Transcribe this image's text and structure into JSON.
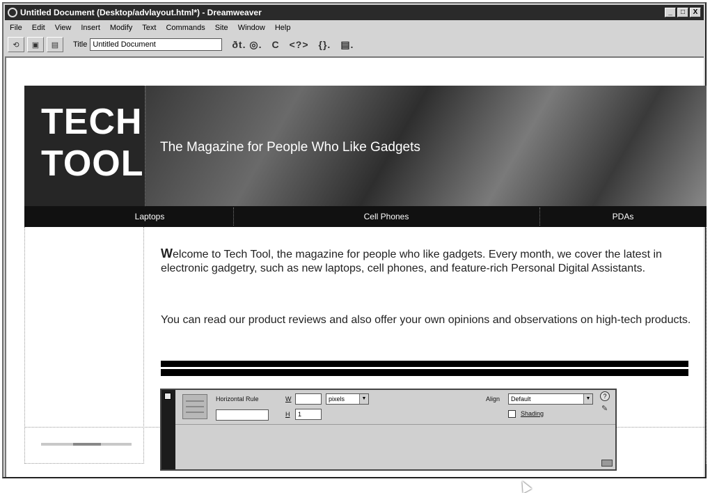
{
  "window": {
    "title": "Untitled Document (Desktop/advlayout.html*) - Dreamweaver",
    "controls": [
      "_",
      "□",
      "X"
    ]
  },
  "menu": [
    "File",
    "Edit",
    "View",
    "Insert",
    "Modify",
    "Text",
    "Commands",
    "Site",
    "Window",
    "Help"
  ],
  "toolbar": {
    "title_label": "Title",
    "title_value": "Untitled Document",
    "symbols": [
      "ðt. ◎.",
      "C",
      "<?>",
      "{}.",
      "▤."
    ]
  },
  "page": {
    "logo_line1": "TECH",
    "logo_line2": "TOOL",
    "tagline": "The Magazine for People Who Like Gadgets",
    "nav": [
      "Laptops",
      "Cell Phones",
      "PDAs"
    ],
    "para1_first": "W",
    "para1_rest": "elcome to Tech Tool, the magazine for people who like gadgets. Every month, we cover the latest in electronic gadgetry, such as new laptops, cell phones, and feature-rich Personal Digital Assistants.",
    "para2": "You can read our product reviews and also offer your own opinions and observations on high-tech products."
  },
  "property_inspector": {
    "element_label": "Horizontal Rule",
    "w_label": "W",
    "h_label": "H",
    "w_value": "",
    "h_value": "1",
    "units": "pixels",
    "align_label": "Align",
    "align_value": "Default",
    "shading_label": "Shading"
  },
  "colors": {
    "header_dark": "#262626",
    "nav_bar": "#111111",
    "titlebar": "#2a2a2a"
  }
}
